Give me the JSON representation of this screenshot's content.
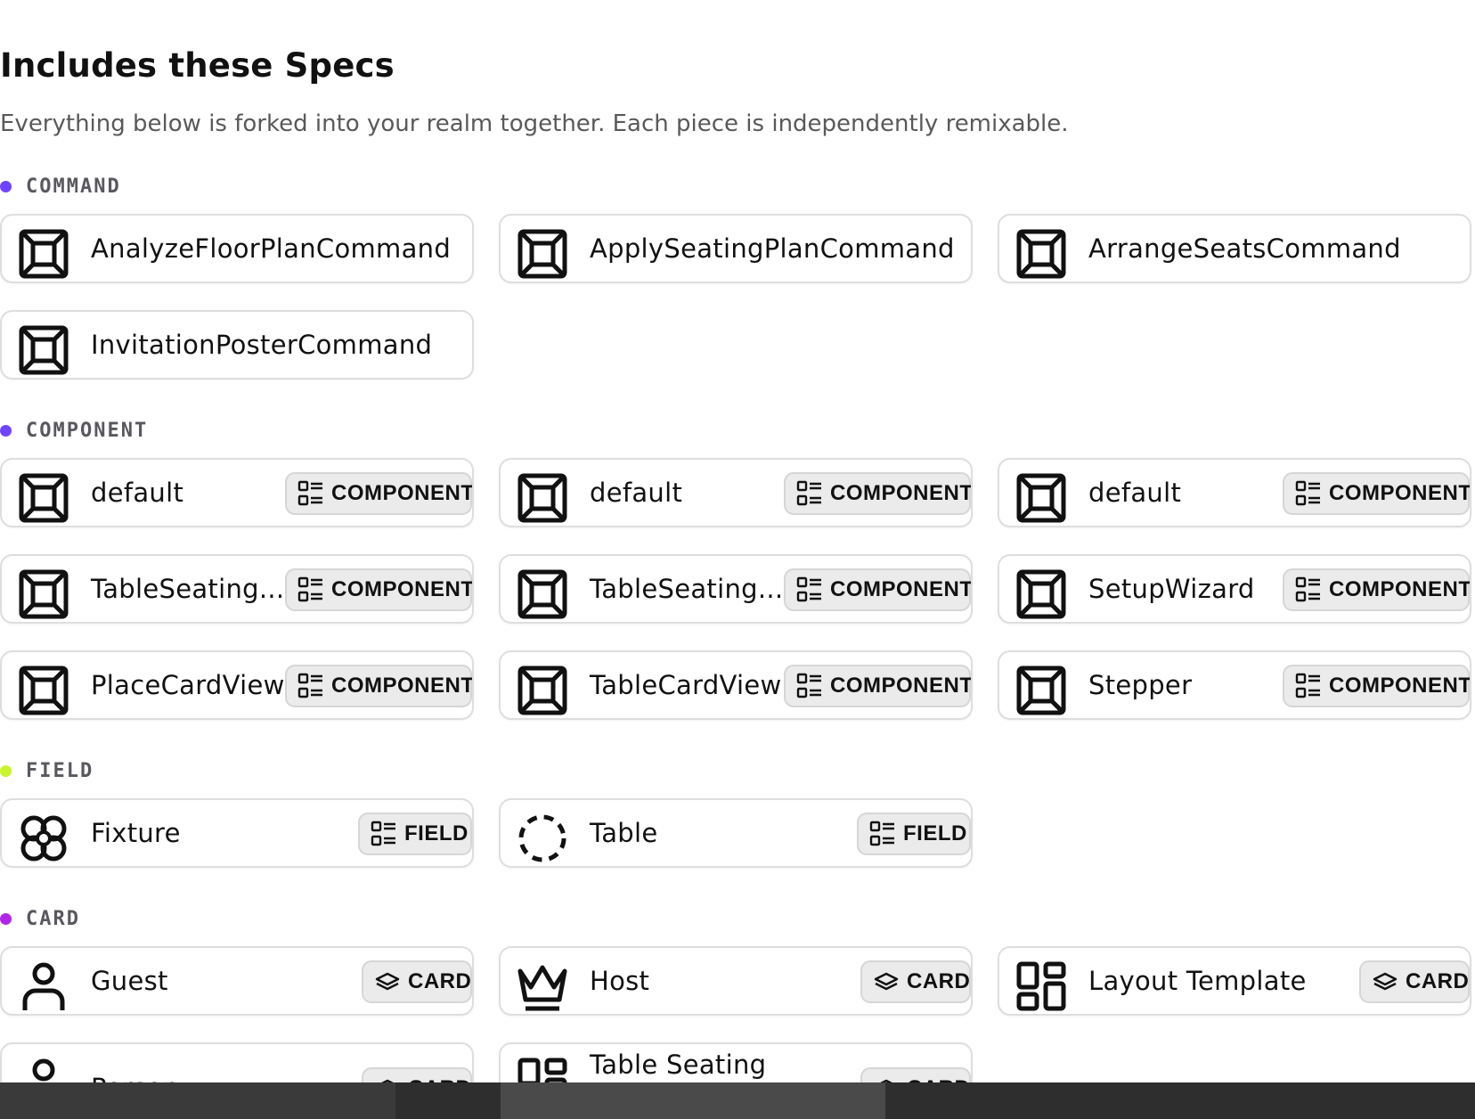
{
  "header": {
    "title": "Includes these Specs",
    "subtitle": "Everything below is forked into your realm together. Each piece is independently remixable."
  },
  "sections": {
    "command": {
      "label": "COMMAND",
      "dot_color": "#6e44ff",
      "items": [
        {
          "name": "AnalyzeFloorPlanCommand",
          "icon": "square-frame-icon"
        },
        {
          "name": "ApplySeatingPlanCommand",
          "icon": "square-frame-icon"
        },
        {
          "name": "ArrangeSeatsCommand",
          "icon": "square-frame-icon"
        },
        {
          "name": "InvitationPosterCommand",
          "icon": "square-frame-icon"
        }
      ]
    },
    "component": {
      "label": "COMPONENT",
      "dot_color": "#6e44ff",
      "badge_label": "COMPONENT",
      "items": [
        {
          "name": "default",
          "icon": "square-frame-icon"
        },
        {
          "name": "default",
          "icon": "square-frame-icon"
        },
        {
          "name": "default",
          "icon": "square-frame-icon"
        },
        {
          "name": "TableSeating...",
          "icon": "square-frame-icon"
        },
        {
          "name": "TableSeating...",
          "icon": "square-frame-icon"
        },
        {
          "name": "SetupWizard",
          "icon": "square-frame-icon"
        },
        {
          "name": "PlaceCardView",
          "icon": "square-frame-icon"
        },
        {
          "name": "TableCardView",
          "icon": "square-frame-icon"
        },
        {
          "name": "Stepper",
          "icon": "square-frame-icon"
        }
      ]
    },
    "field": {
      "label": "FIELD",
      "dot_color": "#c8f52a",
      "badge_label": "FIELD",
      "items": [
        {
          "name": "Fixture",
          "icon": "flower-icon"
        },
        {
          "name": "Table",
          "icon": "dashed-circle-icon"
        }
      ]
    },
    "card": {
      "label": "CARD",
      "dot_color": "#b126e6",
      "badge_label": "CARD",
      "items": [
        {
          "name": "Guest",
          "icon": "user-icon"
        },
        {
          "name": "Host",
          "icon": "crown-icon"
        },
        {
          "name": "Layout Template",
          "icon": "layout-grid-icon"
        },
        {
          "name": "Person",
          "icon": "user-icon"
        },
        {
          "name": "Table Seating",
          "icon": "layout-grid-icon"
        }
      ]
    }
  },
  "badge_icons": {
    "list": "list-icon",
    "layers": "layers-icon"
  }
}
